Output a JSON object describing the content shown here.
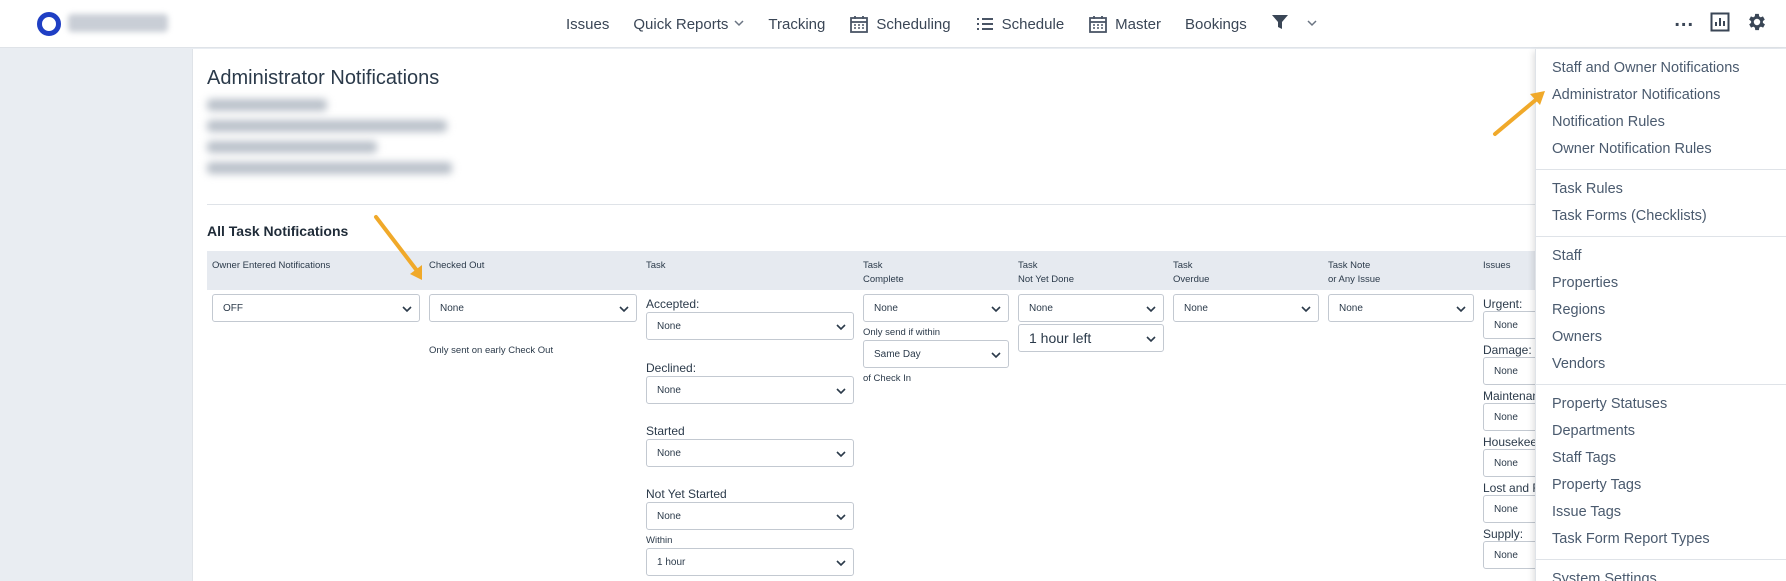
{
  "nav": {
    "items": [
      {
        "label": "Issues",
        "icon": ""
      },
      {
        "label": "Quick Reports",
        "icon": "",
        "dropdown": true
      },
      {
        "label": "Tracking",
        "icon": ""
      },
      {
        "label": "Scheduling",
        "icon": "calendar-icon"
      },
      {
        "label": "Schedule",
        "icon": "list-icon"
      },
      {
        "label": "Master",
        "icon": "calendar-icon"
      },
      {
        "label": "Bookings",
        "icon": ""
      }
    ],
    "more": "..."
  },
  "page": {
    "title": "Administrator Notifications",
    "section_title": "All Task Notifications"
  },
  "table": {
    "headers": [
      "Owner Entered Notifications",
      "Checked Out",
      "Task",
      "Task\nComplete",
      "Task\nNot Yet Done",
      "Task\nOverdue",
      "Task Note\nor Any Issue",
      "Issues"
    ],
    "owner_entered": "OFF",
    "checked_out": "None",
    "checked_out_note": "Only sent on early Check Out",
    "task": {
      "accepted_label": "Accepted:",
      "accepted": "None",
      "declined_label": "Declined:",
      "declined": "None",
      "started_label": "Started",
      "started": "None",
      "not_yet_started_label": "Not Yet Started",
      "not_yet_started": "None",
      "within_label": "Within",
      "within": "1 hour"
    },
    "task_complete": {
      "value": "None",
      "only_send_label": "Only send if within",
      "window": "Same Day",
      "of_checkin_label": "of Check In"
    },
    "task_not_yet_done": {
      "value": "None",
      "time_left": "1 hour left"
    },
    "task_overdue": "None",
    "task_note": "None",
    "issues": [
      {
        "label": "Urgent:",
        "value": "None"
      },
      {
        "label": "Damage:",
        "value": "None"
      },
      {
        "label": "Maintenan",
        "value": "None"
      },
      {
        "label": "Housekeep",
        "value": "None"
      },
      {
        "label": "Lost and F",
        "value": "None"
      },
      {
        "label": "Supply:",
        "value": "None"
      }
    ]
  },
  "menu": {
    "groups": [
      [
        "Staff and Owner Notifications",
        "Administrator Notifications",
        "Notification Rules",
        "Owner Notification Rules"
      ],
      [
        "Task Rules",
        "Task Forms (Checklists)"
      ],
      [
        "Staff",
        "Properties",
        "Regions",
        "Owners",
        "Vendors"
      ],
      [
        "Property Statuses",
        "Departments",
        "Staff Tags",
        "Property Tags",
        "Issue Tags",
        "Task Form Report Types"
      ],
      [
        "System Settings"
      ]
    ]
  },
  "colors": {
    "brand": "#1f3fc4",
    "annotation_arrow": "#f0a92a",
    "header_band": "#e6eaf0",
    "page_bg": "#e9edf2"
  }
}
